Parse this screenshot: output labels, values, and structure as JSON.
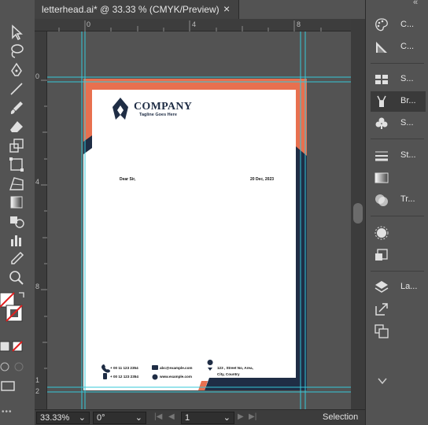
{
  "document_tab": {
    "title": "letterhead.ai* @ 33.33 % (CMYK/Preview)",
    "close_glyph": "×"
  },
  "ruler_top": [
    "0",
    "4",
    "8"
  ],
  "ruler_left": [
    "0",
    "4",
    "8",
    "1",
    "2"
  ],
  "letterhead": {
    "company": "COMPANY",
    "tagline": "Tagline Goes Here",
    "salutation": "Dear Sir,",
    "date": "20 Dec, 2023",
    "phone1": "+ 00 11 123 2354",
    "phone2": "+ 00 12 123 2354",
    "email": "abc@example.com",
    "website": "www.example.com",
    "address_line1": "123 , Street No, Area,",
    "address_line2": "City, Country",
    "colors": {
      "accent": "#e8704f",
      "navy": "#1f2d45"
    }
  },
  "panel": {
    "items": [
      {
        "label": "C...",
        "icon": "color-icon"
      },
      {
        "label": "C...",
        "icon": "color-guide-icon"
      },
      {
        "label": "S...",
        "icon": "swatches-icon"
      },
      {
        "label": "Br...",
        "icon": "brushes-icon"
      },
      {
        "label": "S...",
        "icon": "symbols-icon"
      },
      {
        "label": "St...",
        "icon": "stroke-icon"
      },
      {
        "label": "",
        "icon": "gradient-icon"
      },
      {
        "label": "Tr...",
        "icon": "transparency-icon"
      },
      {
        "label": "",
        "icon": "appearance-icon"
      },
      {
        "label": "",
        "icon": "graphic-styles-icon"
      },
      {
        "label": "La...",
        "icon": "layers-icon"
      },
      {
        "label": "",
        "icon": "export-icon"
      },
      {
        "label": "",
        "icon": "artboards-icon"
      }
    ],
    "collapse_glyph": "«"
  },
  "status": {
    "zoom": "33.33%",
    "rotation": "0°",
    "artboard": "1",
    "tool": "Selection"
  }
}
